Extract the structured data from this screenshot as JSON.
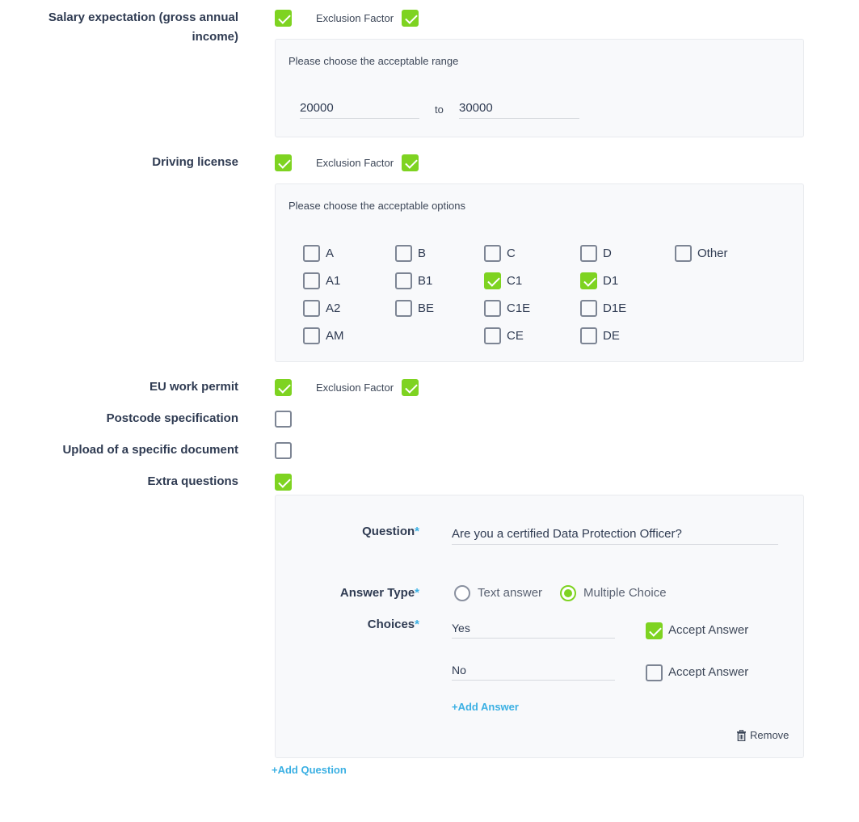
{
  "colors": {
    "accent_green": "#7ed321",
    "link_blue": "#3bb0e3",
    "text": "#2f3b52",
    "panel_bg": "#f8f9fb"
  },
  "salary": {
    "label": "Salary expectation (gross annual income)",
    "checked": true,
    "exclusion_label": "Exclusion Factor",
    "exclusion_checked": true,
    "hint": "Please choose the acceptable range",
    "from_value": "20000",
    "to_label": "to",
    "to_value": "30000"
  },
  "driving": {
    "label": "Driving license",
    "checked": true,
    "exclusion_label": "Exclusion Factor",
    "exclusion_checked": true,
    "hint": "Please choose the acceptable options",
    "options": [
      {
        "label": "A",
        "checked": false
      },
      {
        "label": "B",
        "checked": false
      },
      {
        "label": "C",
        "checked": false
      },
      {
        "label": "D",
        "checked": false
      },
      {
        "label": "Other",
        "checked": false
      },
      {
        "label": "A1",
        "checked": false
      },
      {
        "label": "B1",
        "checked": false
      },
      {
        "label": "C1",
        "checked": true
      },
      {
        "label": "D1",
        "checked": true
      },
      {
        "label": "A2",
        "checked": false
      },
      {
        "label": "BE",
        "checked": false
      },
      {
        "label": "C1E",
        "checked": false
      },
      {
        "label": "D1E",
        "checked": false
      },
      {
        "label": "AM",
        "checked": false
      },
      {
        "label": "CE",
        "checked": false
      },
      {
        "label": "DE",
        "checked": false
      }
    ]
  },
  "eu_permit": {
    "label": "EU work permit",
    "checked": true,
    "exclusion_label": "Exclusion Factor",
    "exclusion_checked": true
  },
  "postcode": {
    "label": "Postcode specification",
    "checked": false
  },
  "upload": {
    "label": "Upload of a specific document",
    "checked": false
  },
  "extra": {
    "label": "Extra questions",
    "checked": true,
    "question_label": "Question",
    "required_mark": "*",
    "question_value": "Are you a certified Data Protection Officer?",
    "answer_type_label": "Answer Type",
    "answer_types": [
      {
        "label": "Text answer",
        "selected": false
      },
      {
        "label": "Multiple Choice",
        "selected": true
      }
    ],
    "choices_label": "Choices",
    "choices": [
      {
        "value": "Yes",
        "accept_label": "Accept Answer",
        "accepted": true
      },
      {
        "value": "No",
        "accept_label": "Accept Answer",
        "accepted": false
      }
    ],
    "add_answer": "+Add Answer",
    "remove": "Remove",
    "add_question": "+Add Question"
  }
}
